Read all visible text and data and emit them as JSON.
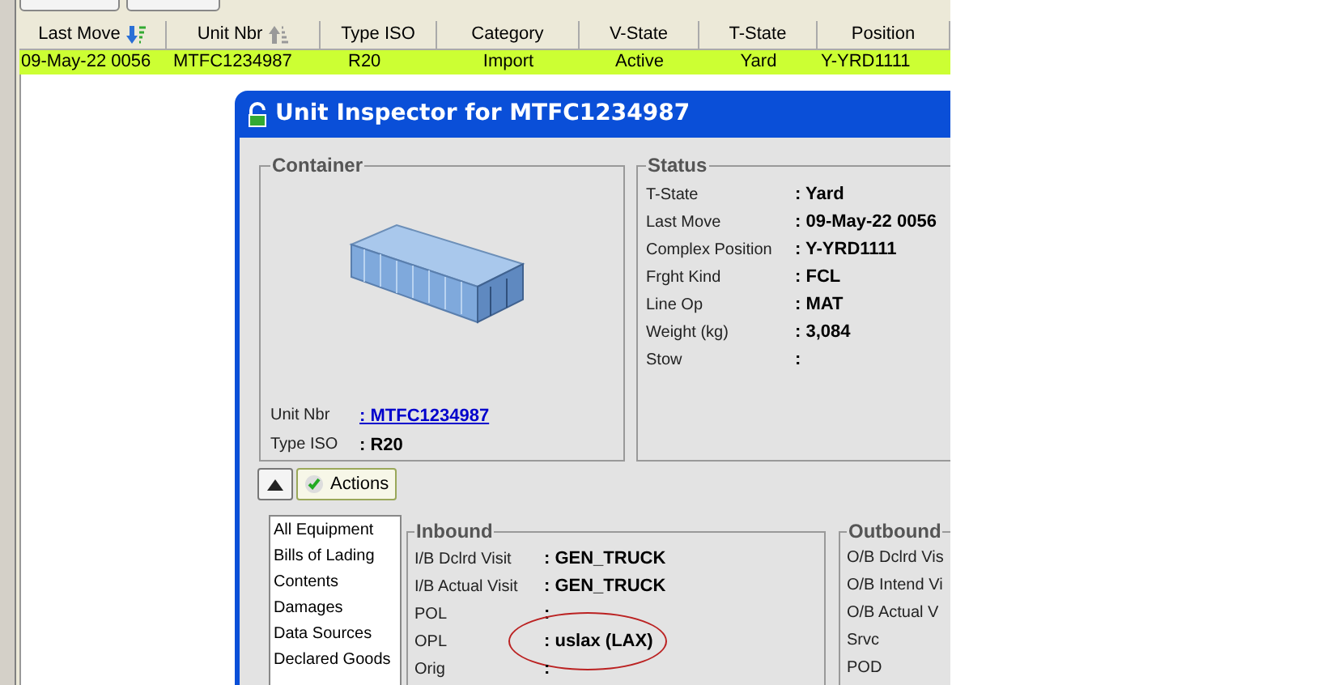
{
  "table": {
    "columns": [
      {
        "label": "Last Move",
        "sorted": true,
        "ascending": false
      },
      {
        "label": "Unit Nbr",
        "sorted": true,
        "ascending": true
      },
      {
        "label": "Type ISO",
        "sorted": false
      },
      {
        "label": "Category",
        "sorted": false
      },
      {
        "label": "V-State",
        "sorted": false
      },
      {
        "label": "T-State",
        "sorted": false
      },
      {
        "label": "Position",
        "sorted": false
      }
    ],
    "rows": [
      {
        "selected": true,
        "cells": [
          "09-May-22 0056",
          "MTFC1234987",
          "R20",
          "Import",
          "Active",
          "Yard",
          "Y-YRD1111"
        ]
      }
    ]
  },
  "inspector": {
    "title": "Unit Inspector for MTFC1234987",
    "container": {
      "heading": "Container",
      "fields": [
        {
          "label": "Unit Nbr",
          "value": ": MTFC1234987",
          "kind": "link"
        },
        {
          "label": "Type ISO",
          "value": ": R20",
          "kind": "text"
        }
      ]
    },
    "status": {
      "heading": "Status",
      "fields": [
        {
          "label": "T-State",
          "value": ": Yard"
        },
        {
          "label": "Last Move",
          "value": ": 09-May-22 0056"
        },
        {
          "label": "Complex Position",
          "value": ": Y-YRD1111"
        },
        {
          "label": "Frght Kind",
          "value": ": FCL"
        },
        {
          "label": "Line Op",
          "value": ": MAT"
        },
        {
          "label": "Weight (kg)",
          "value": ": 3,084"
        },
        {
          "label": "Stow",
          "value": ":"
        }
      ]
    },
    "actions_button": "Actions",
    "sections": [
      "All Equipment",
      "Bills of Lading",
      "Contents",
      "Damages",
      "Data Sources",
      "Declared Goods"
    ],
    "inbound": {
      "heading": "Inbound",
      "fields": [
        {
          "label": "I/B Dclrd Visit",
          "value": ": GEN_TRUCK",
          "circled": false
        },
        {
          "label": "I/B Actual Visit",
          "value": ": GEN_TRUCK",
          "circled": false
        },
        {
          "label": "POL",
          "value": ":",
          "circled": false
        },
        {
          "label": "OPL",
          "value": ": uslax (LAX)",
          "circled": true
        },
        {
          "label": "Orig",
          "value": ":",
          "circled": false
        }
      ]
    },
    "outbound": {
      "heading": "Outbound",
      "labels": [
        "O/B Dclrd Vis",
        "O/B Intend Vi",
        "O/B Actual V",
        "Srvc",
        "POD"
      ]
    }
  }
}
